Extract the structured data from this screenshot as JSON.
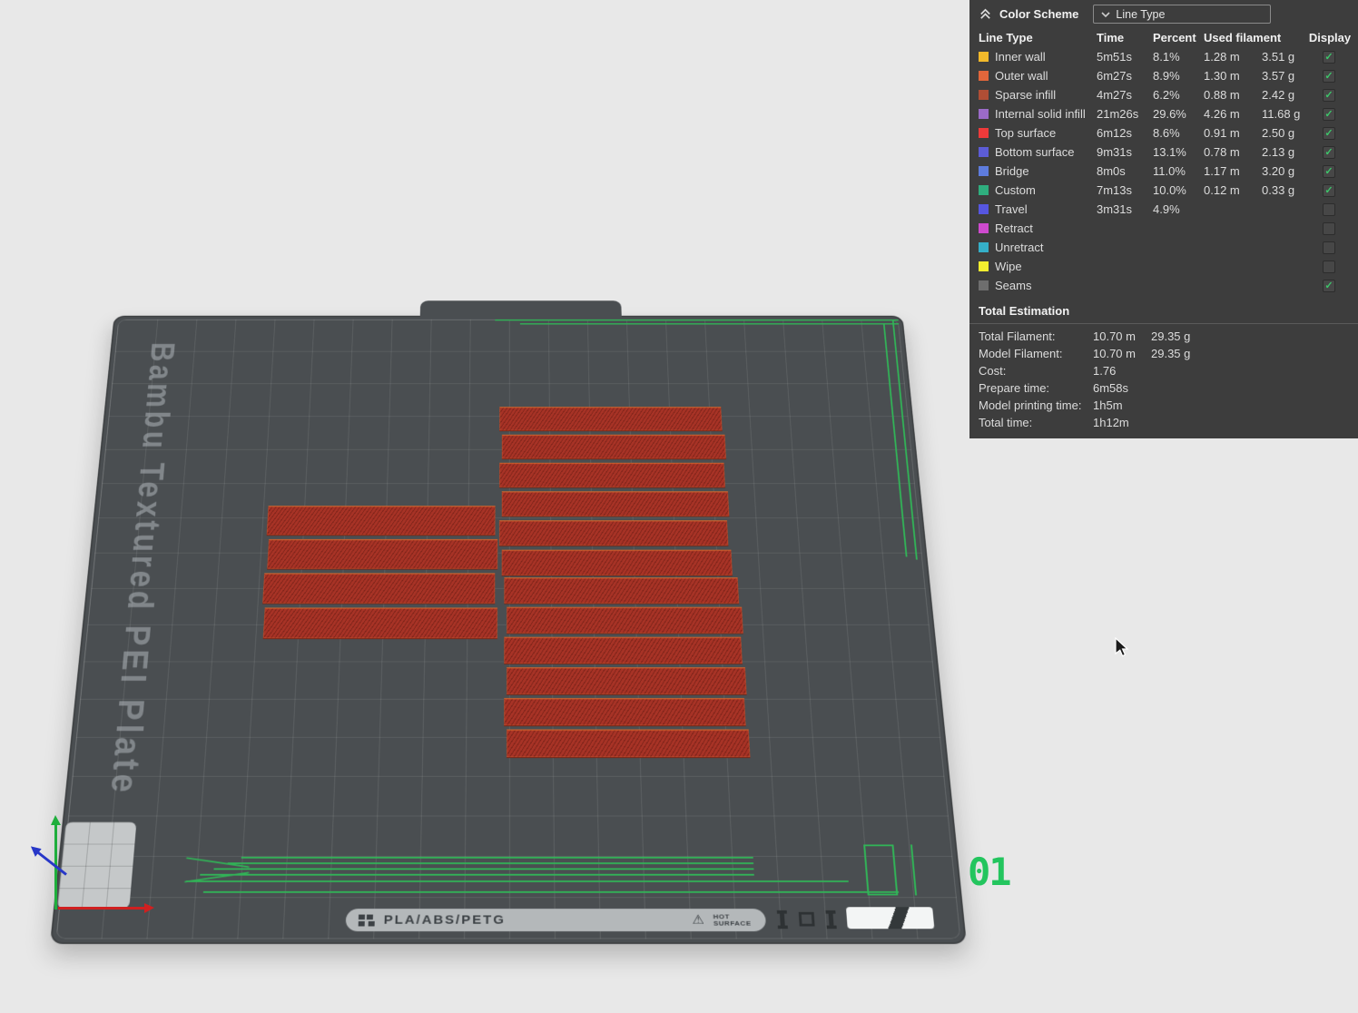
{
  "panel": {
    "header": {
      "title": "Color Scheme",
      "dropdown_value": "Line Type"
    },
    "table": {
      "headers": [
        "Line Type",
        "Time",
        "Percent",
        "Used filament",
        "Display"
      ],
      "rows": [
        {
          "label": "Inner wall",
          "color": "#F2B92B",
          "time": "5m51s",
          "percent": "8.1%",
          "length": "1.28 m",
          "weight": "3.51 g",
          "display": true
        },
        {
          "label": "Outer wall",
          "color": "#E2663B",
          "time": "6m27s",
          "percent": "8.9%",
          "length": "1.30 m",
          "weight": "3.57 g",
          "display": true
        },
        {
          "label": "Sparse infill",
          "color": "#B04E35",
          "time": "4m27s",
          "percent": "6.2%",
          "length": "0.88 m",
          "weight": "2.42 g",
          "display": true
        },
        {
          "label": "Internal solid infill",
          "color": "#9B6BC8",
          "time": "21m26s",
          "percent": "29.6%",
          "length": "4.26 m",
          "weight": "11.68 g",
          "display": true
        },
        {
          "label": "Top surface",
          "color": "#EE3A3A",
          "time": "6m12s",
          "percent": "8.6%",
          "length": "0.91 m",
          "weight": "2.50 g",
          "display": true
        },
        {
          "label": "Bottom surface",
          "color": "#5C5CD6",
          "time": "9m31s",
          "percent": "13.1%",
          "length": "0.78 m",
          "weight": "2.13 g",
          "display": true
        },
        {
          "label": "Bridge",
          "color": "#5E7CDD",
          "time": "8m0s",
          "percent": "11.0%",
          "length": "1.17 m",
          "weight": "3.20 g",
          "display": true
        },
        {
          "label": "Custom",
          "color": "#2FAE7E",
          "time": "7m13s",
          "percent": "10.0%",
          "length": "0.12 m",
          "weight": "0.33 g",
          "display": true
        },
        {
          "label": "Travel",
          "color": "#5656E0",
          "time": "3m31s",
          "percent": "4.9%",
          "length": "",
          "weight": "",
          "display": false
        },
        {
          "label": "Retract",
          "color": "#CE4ACE",
          "time": "",
          "percent": "",
          "length": "",
          "weight": "",
          "display": false
        },
        {
          "label": "Unretract",
          "color": "#35AFC8",
          "time": "",
          "percent": "",
          "length": "",
          "weight": "",
          "display": false
        },
        {
          "label": "Wipe",
          "color": "#F2ED2F",
          "time": "",
          "percent": "",
          "length": "",
          "weight": "",
          "display": false
        },
        {
          "label": "Seams",
          "color": "#6E6E6E",
          "time": "",
          "percent": "",
          "length": "",
          "weight": "",
          "display": true
        }
      ]
    },
    "totals": {
      "title": "Total Estimation",
      "rows": [
        {
          "label": "Total Filament:",
          "value": "10.70 m",
          "value2": "29.35 g"
        },
        {
          "label": "Model Filament:",
          "value": "10.70 m",
          "value2": "29.35 g"
        },
        {
          "label": "Cost:",
          "value": "1.76",
          "value2": ""
        },
        {
          "label": "Prepare time:",
          "value": "6m58s",
          "value2": ""
        },
        {
          "label": "Model printing time:",
          "value": "1h5m",
          "value2": ""
        },
        {
          "label": "Total time:",
          "value": "1h12m",
          "value2": ""
        }
      ]
    }
  },
  "plate": {
    "name": "Bambu Textured PEI Plate",
    "material_label": "PLA/ABS/PETG",
    "surface_label": "HOT SURFACE",
    "plate_number": "01"
  }
}
